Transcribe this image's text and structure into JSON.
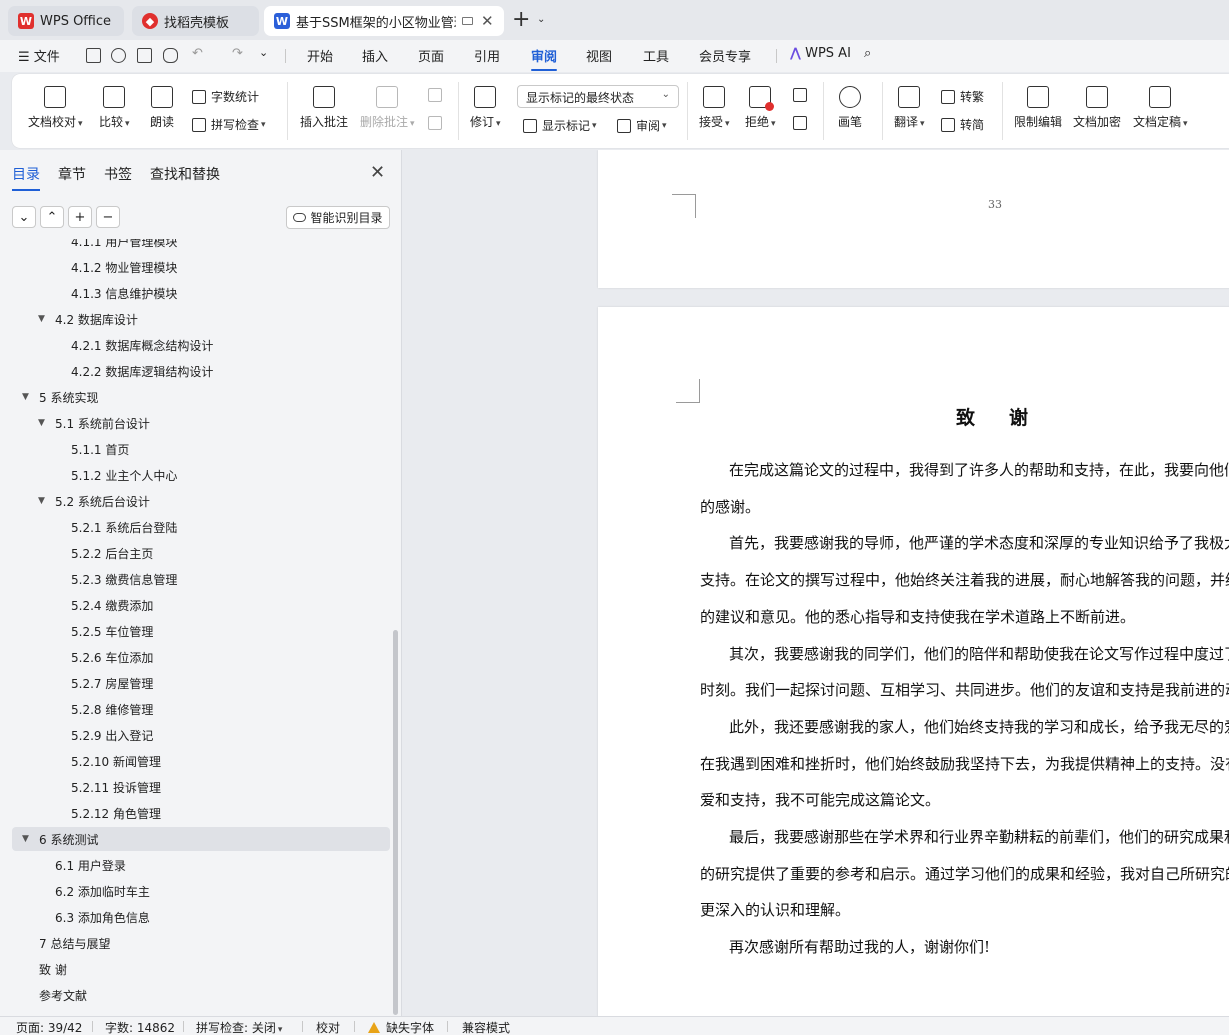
{
  "tabs": [
    {
      "label": "WPS Office",
      "icon": "wps-logo-icon",
      "color": "#e0302e"
    },
    {
      "label": "找稻壳模板",
      "icon": "docer-icon",
      "color": "#e0302e"
    },
    {
      "label": "基于SSM框架的小区物业管理",
      "icon": "word-doc-icon",
      "color": "#2b5fd9"
    }
  ],
  "menu": {
    "file": "文件",
    "items": [
      "开始",
      "插入",
      "页面",
      "引用",
      "审阅",
      "视图",
      "工具",
      "会员专享"
    ],
    "active": "审阅",
    "ai": "WPS AI"
  },
  "ribbon": {
    "doc_check": "文档校对",
    "compare": "比较",
    "read_aloud": "朗读",
    "word_count": "字数统计",
    "spell_check": "拼写检查",
    "insert_comment": "插入批注",
    "delete_comment": "删除批注",
    "track_changes": "修订",
    "markup_state": "显示标记的最终状态",
    "show_markup": "显示标记",
    "review": "审阅",
    "accept": "接受",
    "reject": "拒绝",
    "pen": "画笔",
    "translate": "翻译",
    "to_traditional": "转繁",
    "to_simplified": "转简",
    "restrict_edit": "限制编辑",
    "encrypt": "文档加密",
    "finalize": "文档定稿"
  },
  "sidebar": {
    "tabs": [
      "目录",
      "章节",
      "书签",
      "查找和替换"
    ],
    "active_tab": "目录",
    "smart_toc": "智能识别目录",
    "controls": [
      "⌄",
      "⌃",
      "+",
      "−"
    ],
    "toc": [
      {
        "label": "4.1.1 用户管理模块",
        "level": 3
      },
      {
        "label": "4.1.2  物业管理模块",
        "level": 3
      },
      {
        "label": "4.1.3  信息维护模块",
        "level": 3
      },
      {
        "label": "4.2 数据库设计",
        "level": 2,
        "expanded": true
      },
      {
        "label": "4.2.1  数据库概念结构设计",
        "level": 3
      },
      {
        "label": "4.2.2  数据库逻辑结构设计",
        "level": 3
      },
      {
        "label": "5  系统实现",
        "level": 1,
        "expanded": true
      },
      {
        "label": "5.1 系统前台设计",
        "level": 2,
        "expanded": true
      },
      {
        "label": "5.1.1 首页",
        "level": 3
      },
      {
        "label": "5.1.2 业主个人中心",
        "level": 3
      },
      {
        "label": "5.2 系统后台设计",
        "level": 2,
        "expanded": true
      },
      {
        "label": "5.2.1 系统后台登陆",
        "level": 3
      },
      {
        "label": "5.2.2 后台主页",
        "level": 3
      },
      {
        "label": "5.2.3  缴费信息管理",
        "level": 3
      },
      {
        "label": "5.2.4 缴费添加",
        "level": 3
      },
      {
        "label": "5.2.5 车位管理",
        "level": 3
      },
      {
        "label": "5.2.6 车位添加",
        "level": 3
      },
      {
        "label": "5.2.7  房屋管理",
        "level": 3
      },
      {
        "label": "5.2.8  维修管理",
        "level": 3
      },
      {
        "label": "5.2.9 出入登记",
        "level": 3
      },
      {
        "label": "5.2.10 新闻管理",
        "level": 3
      },
      {
        "label": "5.2.11 投诉管理",
        "level": 3
      },
      {
        "label": "5.2.12  角色管理",
        "level": 3
      },
      {
        "label": "6  系统测试",
        "level": 1,
        "expanded": true,
        "selected": true
      },
      {
        "label": "6.1 用户登录",
        "level": 2
      },
      {
        "label": "6.2 添加临时车主",
        "level": 2
      },
      {
        "label": "6.3 添加角色信息",
        "level": 2
      },
      {
        "label": "7  总结与展望",
        "level": 1
      },
      {
        "label": "致     谢",
        "level": 1
      },
      {
        "label": "参考文献",
        "level": 1
      }
    ]
  },
  "document": {
    "page_number": "33",
    "title": "致谢",
    "lines": [
      {
        "text": "在完成这篇论文的过程中，我得到了许多人的帮助和支持，在此，我要向他们",
        "indent": true
      },
      {
        "text": "的感谢。",
        "indent": false
      },
      {
        "text": "首先，我要感谢我的导师，他严谨的学术态度和深厚的专业知识给予了我极大",
        "indent": true
      },
      {
        "text": "支持。在论文的撰写过程中，他始终关注着我的进展，耐心地解答我的问题，并给",
        "indent": false
      },
      {
        "text": "的建议和意见。他的悉心指导和支持使我在学术道路上不断前进。",
        "indent": false
      },
      {
        "text": "其次，我要感谢我的同学们，他们的陪伴和帮助使我在论文写作过程中度过了",
        "indent": true
      },
      {
        "text": "时刻。我们一起探讨问题、互相学习、共同进步。他们的友谊和支持是我前进的动",
        "indent": false
      },
      {
        "text": "此外，我还要感谢我的家人，他们始终支持我的学习和成长，给予我无尽的爱",
        "indent": true
      },
      {
        "text": "在我遇到困难和挫折时，他们始终鼓励我坚持下去，为我提供精神上的支持。没有",
        "indent": false
      },
      {
        "text": "爱和支持，我不可能完成这篇论文。",
        "indent": false
      },
      {
        "text": "最后，我要感谢那些在学术界和行业界辛勤耕耘的前辈们，他们的研究成果和",
        "indent": true
      },
      {
        "text": "的研究提供了重要的参考和启示。通过学习他们的成果和经验，我对自己所研究的",
        "indent": false
      },
      {
        "text": "更深入的认识和理解。",
        "indent": false
      },
      {
        "text": "再次感谢所有帮助过我的人，谢谢你们!",
        "indent": true
      }
    ]
  },
  "status": {
    "page": "页面: 39/42",
    "words": "字数: 14862",
    "spell": "拼写检查: 关闭",
    "proofread": "校对",
    "missing_font": "缺失字体",
    "compat": "兼容模式"
  },
  "colors": {
    "accent": "#1f5fd6",
    "wps_red": "#e0302e",
    "warning": "#e8a317"
  }
}
